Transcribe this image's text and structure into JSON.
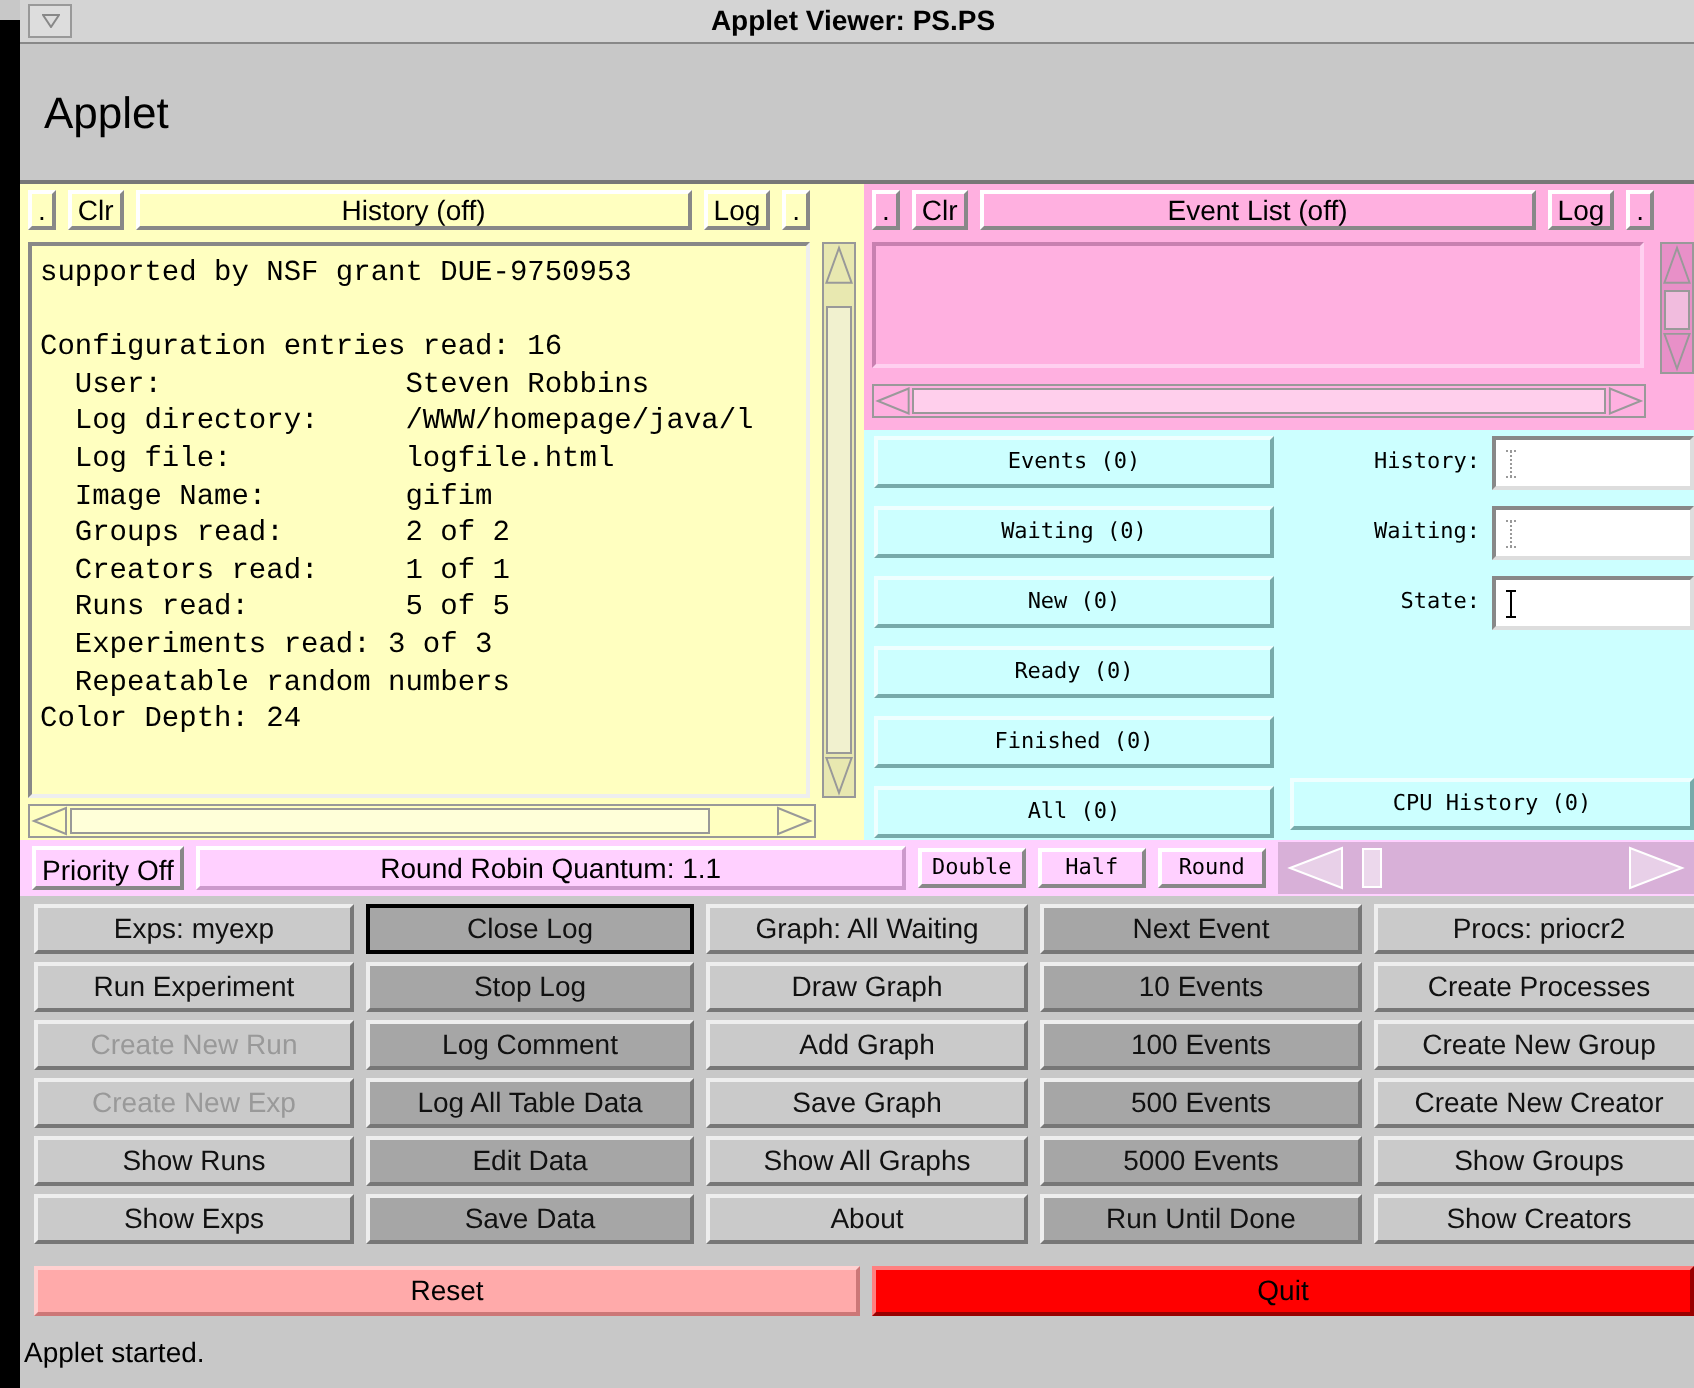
{
  "window": {
    "title": "Applet Viewer: PS.PS",
    "heading": "Applet"
  },
  "history_panel": {
    "buttons": [
      {
        "label": ".",
        "kind": "small"
      },
      {
        "label": "Clr",
        "kind": "small"
      },
      {
        "label": "History (off)",
        "kind": "wide"
      },
      {
        "label": "Log",
        "kind": "small"
      },
      {
        "label": ".",
        "kind": "small"
      }
    ],
    "paragraphs": [
      {
        "lines": [
          "supported by NSF grant DUE-9750953"
        ]
      },
      {
        "lines": [
          "Configuration entries read: 16",
          "  User:              Steven Robbins",
          "  Log directory:     /WWW/homepage/java/l",
          "  Log file:          logfile.html",
          "  Image Name:        gifim",
          "  Groups read:       2 of 2",
          "  Creators read:     1 of 1",
          "  Runs read:         5 of 5",
          "  Experiments read: 3 of 3",
          "  Repeatable random numbers",
          "Color Depth: 24"
        ]
      }
    ]
  },
  "event_panel": {
    "buttons": [
      {
        "label": ".",
        "kind": "small"
      },
      {
        "label": "Clr",
        "kind": "small"
      },
      {
        "label": "Event List (off)",
        "kind": "wide"
      },
      {
        "label": "Log",
        "kind": "small"
      },
      {
        "label": ".",
        "kind": "small"
      }
    ]
  },
  "queue_buttons": [
    "Events (0)",
    "Waiting (0)",
    "New (0)",
    "Ready (0)",
    "Finished (0)",
    "All (0)"
  ],
  "fields": [
    {
      "label": "History:",
      "focused": false
    },
    {
      "label": "Waiting:",
      "focused": false
    },
    {
      "label": "State:",
      "focused": true
    }
  ],
  "cpu_history_button": "CPU History (0)",
  "quantum_row": {
    "priority_button": "Priority Off",
    "quantum_label": "Round Robin Quantum: 1.1",
    "buttons": [
      "Double",
      "Half",
      "Round"
    ]
  },
  "button_columns": [
    {
      "color": "#cacaca",
      "buttons": [
        {
          "label": "Exps: myexp",
          "disabled": false,
          "focused": false
        },
        {
          "label": "Run Experiment",
          "disabled": false,
          "focused": false
        },
        {
          "label": "Create New Run",
          "disabled": true,
          "focused": false
        },
        {
          "label": "Create New Exp",
          "disabled": true,
          "focused": false
        },
        {
          "label": "Show Runs",
          "disabled": false,
          "focused": false
        },
        {
          "label": "Show Exps",
          "disabled": false,
          "focused": false
        }
      ]
    },
    {
      "color": "#a6a6a6",
      "buttons": [
        {
          "label": "Close Log",
          "disabled": false,
          "focused": true
        },
        {
          "label": "Stop Log",
          "disabled": false,
          "focused": false
        },
        {
          "label": "Log Comment",
          "disabled": false,
          "focused": false
        },
        {
          "label": "Log All Table Data",
          "disabled": false,
          "focused": false
        },
        {
          "label": "Edit Data",
          "disabled": false,
          "focused": false
        },
        {
          "label": "Save Data",
          "disabled": false,
          "focused": false
        }
      ]
    },
    {
      "color": "#cacaca",
      "buttons": [
        {
          "label": "Graph: All Waiting",
          "disabled": false,
          "focused": false
        },
        {
          "label": "Draw Graph",
          "disabled": false,
          "focused": false
        },
        {
          "label": "Add Graph",
          "disabled": false,
          "focused": false
        },
        {
          "label": "Save Graph",
          "disabled": false,
          "focused": false
        },
        {
          "label": "Show All Graphs",
          "disabled": false,
          "focused": false
        },
        {
          "label": "About",
          "disabled": false,
          "focused": false
        }
      ]
    },
    {
      "color": "#a6a6a6",
      "buttons": [
        {
          "label": "Next Event",
          "disabled": false,
          "focused": false
        },
        {
          "label": "10 Events",
          "disabled": false,
          "focused": false
        },
        {
          "label": "100 Events",
          "disabled": false,
          "focused": false
        },
        {
          "label": "500 Events",
          "disabled": false,
          "focused": false
        },
        {
          "label": "5000 Events",
          "disabled": false,
          "focused": false
        },
        {
          "label": "Run Until Done",
          "disabled": false,
          "focused": false
        }
      ]
    },
    {
      "color": "#cacaca",
      "buttons": [
        {
          "label": "Procs: priocr2",
          "disabled": false,
          "focused": false
        },
        {
          "label": "Create Processes",
          "disabled": false,
          "focused": false
        },
        {
          "label": "Create New Group",
          "disabled": false,
          "focused": false
        },
        {
          "label": "Create New Creator",
          "disabled": false,
          "focused": false
        },
        {
          "label": "Show Groups",
          "disabled": false,
          "focused": false
        },
        {
          "label": "Show Creators",
          "disabled": false,
          "focused": false
        }
      ]
    }
  ],
  "reset_button": "Reset",
  "quit_button": "Quit",
  "status_bar": "Applet started."
}
